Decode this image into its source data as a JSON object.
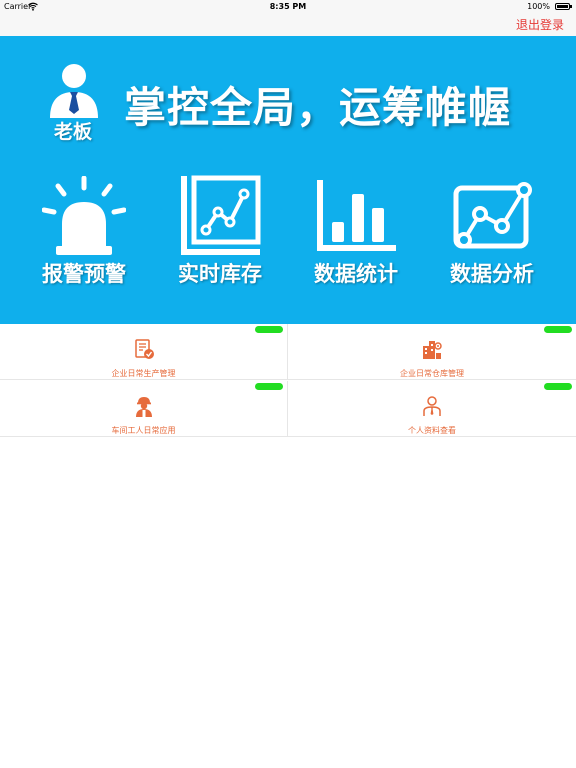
{
  "status": {
    "carrier": "Carrier",
    "time": "8:35 PM",
    "battery": "100%",
    "battery_level": 1.0
  },
  "nav": {
    "logout_label": "退出登录",
    "logout_color": "#e53935"
  },
  "banner": {
    "background": "#0fafec",
    "boss_label": "老板",
    "slogan": "掌控全局，运筹帷幄",
    "features": [
      {
        "label": "报警预警",
        "icon": "alarm-light-icon"
      },
      {
        "label": "实时库存",
        "icon": "line-chart-icon"
      },
      {
        "label": "数据统计",
        "icon": "bar-chart-icon"
      },
      {
        "label": "数据分析",
        "icon": "analysis-chart-icon"
      }
    ]
  },
  "modules": [
    {
      "label": "企业日常生产管理",
      "badge": "",
      "icon": "production-checklist-icon"
    },
    {
      "label": "企业日常仓库管理",
      "badge": "",
      "icon": "warehouse-building-icon"
    },
    {
      "label": "车间工人日常应用",
      "badge": "",
      "icon": "worker-helmet-icon"
    },
    {
      "label": "个人资料查看",
      "badge": "",
      "icon": "personal-profile-icon"
    }
  ],
  "accent_color": "#e66b3c",
  "badge_color": "#22dd22"
}
